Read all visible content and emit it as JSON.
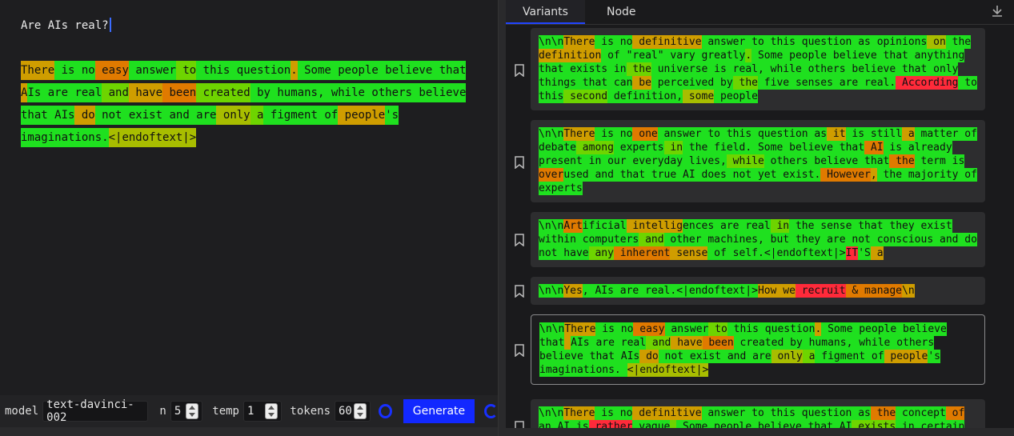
{
  "prompt": {
    "text": "Are AIs real?"
  },
  "colors": {
    "g": "#1fe01f",
    "l": "#6ed400",
    "y": "#a8bd00",
    "o": "#cf9d00",
    "d": "#e07a00",
    "r": "#ff2a3a",
    "accent": "#1228ff"
  },
  "completion": [
    [
      "There",
      "o"
    ],
    [
      " is",
      "g"
    ],
    [
      " no",
      "g"
    ],
    [
      " easy",
      "d"
    ],
    [
      " answer",
      "g"
    ],
    [
      " to",
      "l"
    ],
    [
      " this",
      "g"
    ],
    [
      " question",
      "g"
    ],
    [
      ".",
      "o"
    ],
    [
      " Some",
      "g"
    ],
    [
      " people",
      "g"
    ],
    [
      " believe",
      "g"
    ],
    [
      " that",
      "g"
    ],
    [
      " A",
      "o"
    ],
    [
      "Is",
      "g"
    ],
    [
      " are",
      "g"
    ],
    [
      " real",
      "g"
    ],
    [
      " and",
      "l"
    ],
    [
      " have",
      "o"
    ],
    [
      " been",
      "d"
    ],
    [
      " created",
      "l"
    ],
    [
      " by",
      "g"
    ],
    [
      " humans",
      "g"
    ],
    [
      ",",
      "g"
    ],
    [
      " while",
      "g"
    ],
    [
      " others",
      "g"
    ],
    [
      " believe",
      "g"
    ],
    [
      " that",
      "g"
    ],
    [
      " AIs",
      "g"
    ],
    [
      " do",
      "o"
    ],
    [
      " not",
      "g"
    ],
    [
      " exist",
      "g"
    ],
    [
      " and",
      "g"
    ],
    [
      " are",
      "g"
    ],
    [
      " only",
      "y"
    ],
    [
      " a",
      "l"
    ],
    [
      " figment",
      "g"
    ],
    [
      " of",
      "g"
    ],
    [
      " people",
      "o"
    ],
    [
      "'s",
      "g"
    ],
    [
      " imaginations",
      "g"
    ],
    [
      ".",
      "g"
    ],
    [
      "<|endoftext|>",
      "y"
    ]
  ],
  "toolbar": {
    "model_label": "model",
    "model_value": "text-davinci-002",
    "n_label": "n",
    "n_value": "5",
    "temp_label": "temp",
    "temp_value": "1",
    "tokens_label": "tokens",
    "tokens_value": "60",
    "generate_label": "Generate"
  },
  "tabs": [
    {
      "label": "Variants"
    },
    {
      "label": "Node"
    }
  ],
  "variants": [
    {
      "tokens": [
        [
          "\\n\\n",
          "g"
        ],
        [
          "There",
          "o"
        ],
        [
          " is",
          "g"
        ],
        [
          " no",
          "g"
        ],
        [
          " definitive",
          "o"
        ],
        [
          " answer",
          "g"
        ],
        [
          " to",
          "g"
        ],
        [
          " this",
          "g"
        ],
        [
          " question",
          "g"
        ],
        [
          " as",
          "g"
        ],
        [
          " opinions",
          "g"
        ],
        [
          " on",
          "y"
        ],
        [
          " the",
          "g"
        ],
        [
          " ",
          "d"
        ],
        [
          "definition",
          "o"
        ],
        [
          " of",
          "g"
        ],
        [
          " \"real\"",
          "g"
        ],
        [
          " vary",
          "g"
        ],
        [
          " greatly",
          "g"
        ],
        [
          ".",
          "l"
        ],
        [
          " Some",
          "g"
        ],
        [
          " people",
          "g"
        ],
        [
          " believe",
          "g"
        ],
        [
          " that",
          "g"
        ],
        [
          " anything",
          "g"
        ],
        [
          " that",
          "g"
        ],
        [
          " exists",
          "g"
        ],
        [
          " in",
          "g"
        ],
        [
          " the",
          "l"
        ],
        [
          " universe",
          "g"
        ],
        [
          " is",
          "g"
        ],
        [
          " real",
          "g"
        ],
        [
          ",",
          "g"
        ],
        [
          " while",
          "g"
        ],
        [
          " others",
          "g"
        ],
        [
          " believe",
          "g"
        ],
        [
          " that",
          "g"
        ],
        [
          " only",
          "g"
        ],
        [
          " things",
          "g"
        ],
        [
          " that",
          "g"
        ],
        [
          " can",
          "g"
        ],
        [
          " be",
          "o"
        ],
        [
          " perceived",
          "g"
        ],
        [
          " by",
          "g"
        ],
        [
          " the",
          "l"
        ],
        [
          " five",
          "g"
        ],
        [
          " senses",
          "g"
        ],
        [
          " are",
          "g"
        ],
        [
          " real",
          "g"
        ],
        [
          ".",
          "g"
        ],
        [
          " According",
          "r"
        ],
        [
          " to",
          "g"
        ],
        [
          " this",
          "g"
        ],
        [
          " second",
          "l"
        ],
        [
          " definition",
          "g"
        ],
        [
          ",",
          "g"
        ],
        [
          " some",
          "y"
        ],
        [
          " people",
          "g"
        ]
      ]
    },
    {
      "tokens": [
        [
          "\\n\\n",
          "g"
        ],
        [
          "There",
          "o"
        ],
        [
          " is",
          "g"
        ],
        [
          " no",
          "g"
        ],
        [
          " one",
          "d"
        ],
        [
          " answer",
          "g"
        ],
        [
          " to",
          "g"
        ],
        [
          " this",
          "g"
        ],
        [
          " question",
          "g"
        ],
        [
          " as",
          "g"
        ],
        [
          " it",
          "o"
        ],
        [
          " is",
          "g"
        ],
        [
          " still",
          "g"
        ],
        [
          " a",
          "o"
        ],
        [
          " matter",
          "g"
        ],
        [
          " of",
          "g"
        ],
        [
          " ",
          "o"
        ],
        [
          "debate",
          "g"
        ],
        [
          " among",
          "l"
        ],
        [
          " experts",
          "g"
        ],
        [
          " in",
          "l"
        ],
        [
          " the",
          "g"
        ],
        [
          " field",
          "g"
        ],
        [
          ".",
          "g"
        ],
        [
          " Some",
          "g"
        ],
        [
          " believe",
          "g"
        ],
        [
          " that",
          "g"
        ],
        [
          " AI",
          "d"
        ],
        [
          " is",
          "g"
        ],
        [
          " already",
          "g"
        ],
        [
          " ",
          "o"
        ],
        [
          "present",
          "g"
        ],
        [
          " in",
          "g"
        ],
        [
          " our",
          "g"
        ],
        [
          " everyday",
          "g"
        ],
        [
          " lives",
          "g"
        ],
        [
          ",",
          "g"
        ],
        [
          " while",
          "l"
        ],
        [
          " others",
          "g"
        ],
        [
          " believe",
          "g"
        ],
        [
          " that",
          "g"
        ],
        [
          " the",
          "d"
        ],
        [
          " term",
          "g"
        ],
        [
          " is",
          "g"
        ],
        [
          " ",
          "d"
        ],
        [
          "over",
          "d"
        ],
        [
          "used",
          "g"
        ],
        [
          " and",
          "g"
        ],
        [
          " that",
          "g"
        ],
        [
          " true",
          "g"
        ],
        [
          " AI",
          "g"
        ],
        [
          " does",
          "g"
        ],
        [
          " not",
          "g"
        ],
        [
          " yet",
          "g"
        ],
        [
          " exist",
          "g"
        ],
        [
          ".",
          "g"
        ],
        [
          " However",
          "d"
        ],
        [
          ",",
          "o"
        ],
        [
          " the",
          "g"
        ],
        [
          " majority",
          "g"
        ],
        [
          " of",
          "g"
        ],
        [
          " ",
          "g"
        ],
        [
          "experts",
          "g"
        ]
      ]
    },
    {
      "tokens": [
        [
          "\\n\\n",
          "g"
        ],
        [
          "Art",
          "d"
        ],
        [
          "ificial",
          "g"
        ],
        [
          " intellig",
          "o"
        ],
        [
          "ences",
          "g"
        ],
        [
          " are",
          "g"
        ],
        [
          " real",
          "g"
        ],
        [
          " in",
          "l"
        ],
        [
          " the",
          "g"
        ],
        [
          " sense",
          "g"
        ],
        [
          " that",
          "g"
        ],
        [
          " they",
          "g"
        ],
        [
          " exist",
          "g"
        ],
        [
          " ",
          "o"
        ],
        [
          "within",
          "g"
        ],
        [
          " computers",
          "g"
        ],
        [
          " and",
          "l"
        ],
        [
          " other",
          "g"
        ],
        [
          " machines",
          "g"
        ],
        [
          ",",
          "g"
        ],
        [
          " but",
          "g"
        ],
        [
          " they",
          "g"
        ],
        [
          " are",
          "g"
        ],
        [
          " not",
          "g"
        ],
        [
          " conscious",
          "g"
        ],
        [
          " and",
          "g"
        ],
        [
          " do",
          "g"
        ],
        [
          " ",
          "g"
        ],
        [
          "not",
          "g"
        ],
        [
          " have",
          "g"
        ],
        [
          " any",
          "l"
        ],
        [
          " inherent",
          "d"
        ],
        [
          " sense",
          "o"
        ],
        [
          " of",
          "g"
        ],
        [
          " self",
          "g"
        ],
        [
          ".",
          "g"
        ],
        [
          "<|endoftext|>",
          "g"
        ],
        [
          "IT",
          "r"
        ],
        [
          "'S",
          "g"
        ],
        [
          " a",
          "o"
        ]
      ]
    },
    {
      "tokens": [
        [
          "\\n\\n",
          "g"
        ],
        [
          "Yes",
          "o"
        ],
        [
          ",",
          "g"
        ],
        [
          " AIs",
          "g"
        ],
        [
          " are",
          "g"
        ],
        [
          " real",
          "g"
        ],
        [
          ".",
          "g"
        ],
        [
          "<|endoftext|>",
          "g"
        ],
        [
          "How",
          "o"
        ],
        [
          " we",
          "o"
        ],
        [
          " recruit",
          "r"
        ],
        [
          " &",
          "d"
        ],
        [
          " manage",
          "d"
        ],
        [
          "\\n",
          "o"
        ]
      ]
    },
    {
      "tokens": [
        [
          "\\n\\n",
          "g"
        ],
        [
          "There",
          "o"
        ],
        [
          " is",
          "g"
        ],
        [
          " no",
          "g"
        ],
        [
          " easy",
          "d"
        ],
        [
          " answer",
          "g"
        ],
        [
          " to",
          "l"
        ],
        [
          " this",
          "g"
        ],
        [
          " question",
          "g"
        ],
        [
          ".",
          "o"
        ],
        [
          " Some",
          "g"
        ],
        [
          " people",
          "g"
        ],
        [
          " believe",
          "g"
        ],
        [
          " that",
          "g"
        ],
        [
          " ",
          "o"
        ],
        [
          "AIs",
          "g"
        ],
        [
          " are",
          "g"
        ],
        [
          " real",
          "g"
        ],
        [
          " and",
          "l"
        ],
        [
          " have",
          "o"
        ],
        [
          " been",
          "d"
        ],
        [
          " created",
          "g"
        ],
        [
          " by",
          "g"
        ],
        [
          " humans",
          "g"
        ],
        [
          ",",
          "g"
        ],
        [
          " while",
          "g"
        ],
        [
          " others",
          "g"
        ],
        [
          " believe",
          "g"
        ],
        [
          " that",
          "g"
        ],
        [
          " ",
          "g"
        ],
        [
          "AIs",
          "g"
        ],
        [
          " do",
          "o"
        ],
        [
          " not",
          "g"
        ],
        [
          " exist",
          "g"
        ],
        [
          " and",
          "g"
        ],
        [
          " are",
          "g"
        ],
        [
          " only",
          "y"
        ],
        [
          " a",
          "l"
        ],
        [
          " figment",
          "g"
        ],
        [
          " of",
          "g"
        ],
        [
          " people",
          "o"
        ],
        [
          "'s",
          "g"
        ],
        [
          " imaginations",
          "g"
        ],
        [
          ".",
          "g"
        ],
        [
          " ",
          "g"
        ],
        [
          "<|endoftext|>",
          "y"
        ]
      ]
    },
    {
      "tokens": [
        [
          "\\n\\n",
          "g"
        ],
        [
          "There",
          "o"
        ],
        [
          " is",
          "g"
        ],
        [
          " no",
          "g"
        ],
        [
          " definitive",
          "o"
        ],
        [
          " answer",
          "g"
        ],
        [
          " to",
          "g"
        ],
        [
          " this",
          "g"
        ],
        [
          " question",
          "g"
        ],
        [
          " as",
          "g"
        ],
        [
          " the",
          "d"
        ],
        [
          " concept",
          "g"
        ],
        [
          " of",
          "d"
        ],
        [
          " an",
          "g"
        ],
        [
          " ",
          "g"
        ],
        [
          "AI",
          "g"
        ],
        [
          " is",
          "g"
        ],
        [
          " rather",
          "r"
        ],
        [
          " vague",
          "g"
        ],
        [
          ".",
          "l"
        ],
        [
          " Some",
          "g"
        ],
        [
          " people",
          "g"
        ],
        [
          " believe",
          "g"
        ],
        [
          " that",
          "g"
        ],
        [
          " AI",
          "g"
        ],
        [
          " exists",
          "l"
        ],
        [
          " in",
          "g"
        ],
        [
          " certain",
          "g"
        ]
      ]
    }
  ]
}
